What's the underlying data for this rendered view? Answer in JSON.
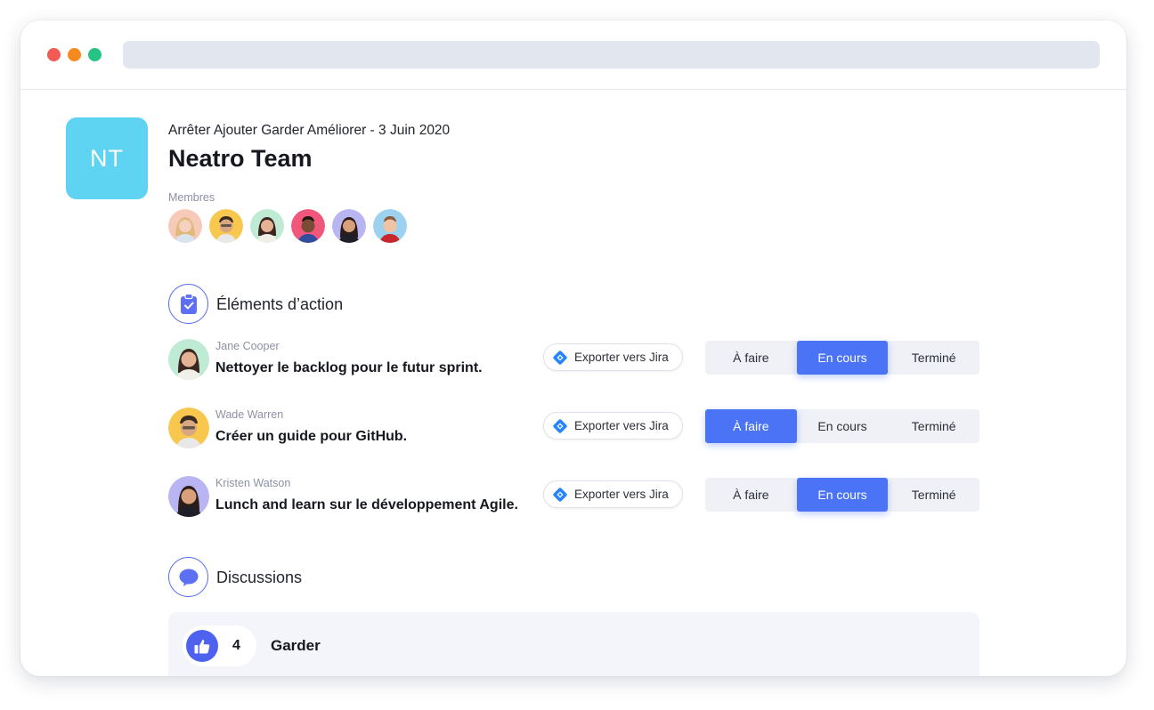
{
  "team": {
    "initials": "NT",
    "meeting_subtitle": "Arrêter Ajouter Garder Améliorer - 3 Juin 2020",
    "name": "Neatro Team",
    "members_label": "Membres",
    "avatar_color": "#5fd3f2"
  },
  "members": [
    {
      "name": "member-1",
      "bg": "#f7c9b8"
    },
    {
      "name": "member-2",
      "bg": "#f8c74e"
    },
    {
      "name": "member-3",
      "bg": "#bfead4"
    },
    {
      "name": "member-4",
      "bg": "#f0577a"
    },
    {
      "name": "member-5",
      "bg": "#b9b4f2"
    },
    {
      "name": "member-6",
      "bg": "#9cd1f0"
    }
  ],
  "action_items": {
    "title": "Éléments d’action",
    "items": [
      {
        "person": "Jane Cooper",
        "text": "Nettoyer le backlog pour le futur sprint.",
        "export_label": "Exporter vers Jira",
        "status": "En cours",
        "avatar_bg": "#bfead4"
      },
      {
        "person": "Wade Warren",
        "text": "Créer un guide pour GitHub.",
        "export_label": "Exporter vers Jira",
        "status": "À faire",
        "avatar_bg": "#f8c74e"
      },
      {
        "person": "Kristen Watson",
        "text": "Lunch and learn sur le développement Agile.",
        "export_label": "Exporter vers Jira",
        "status": "En cours",
        "avatar_bg": "#b9b4f2"
      }
    ],
    "status_options": [
      "À faire",
      "En cours",
      "Terminé"
    ]
  },
  "discussions": {
    "title": "Discussions",
    "items": [
      {
        "votes": "4",
        "title": "Garder"
      }
    ]
  },
  "colors": {
    "accent": "#4a73f5",
    "icon_accent": "#5d6ff2",
    "jira_blue": "#2684ff"
  }
}
